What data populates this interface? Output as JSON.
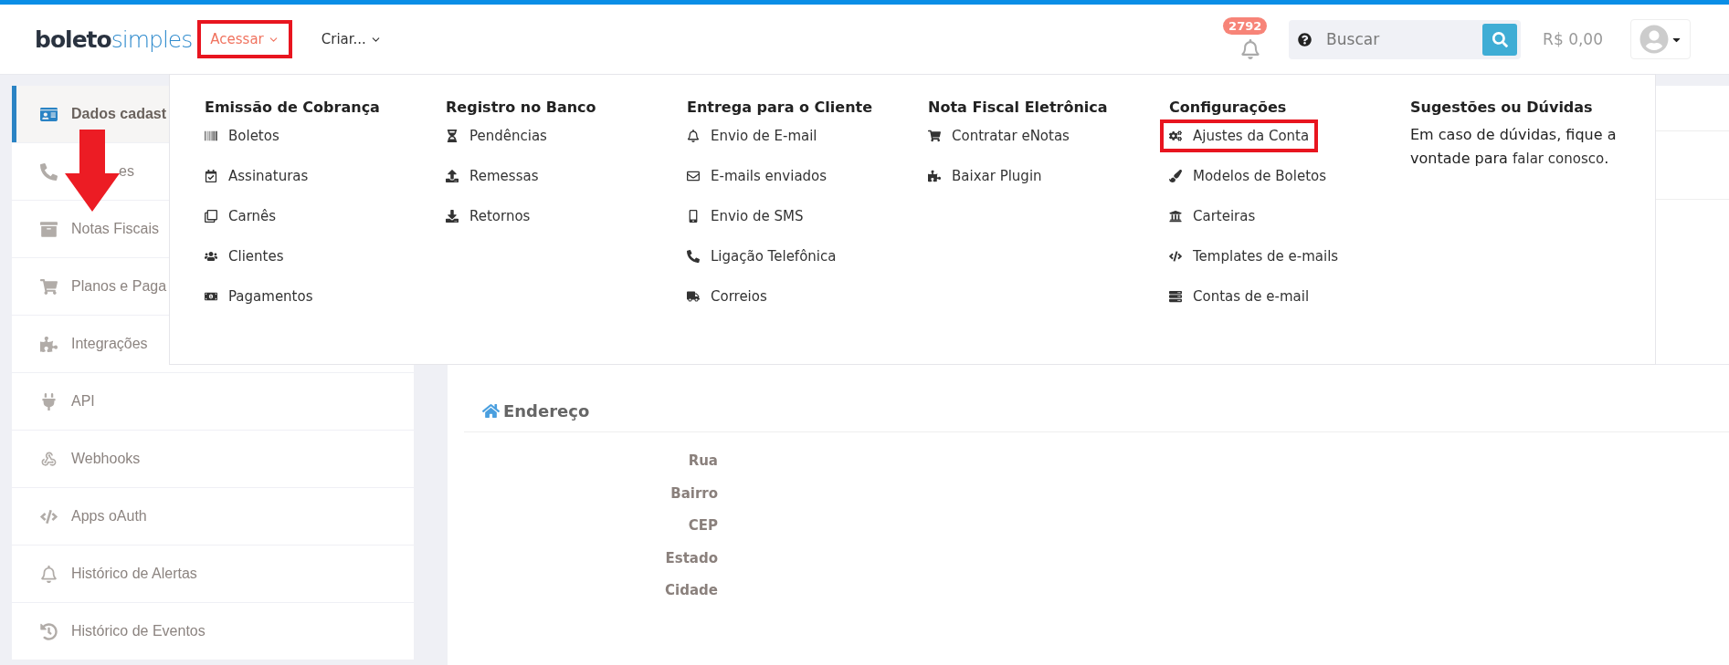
{
  "logo": {
    "dark": "boleto",
    "light": "simples"
  },
  "nav": [
    {
      "label": "Acessar",
      "open": true,
      "highlighted": true
    },
    {
      "label": "Criar...",
      "open": false,
      "highlighted": false
    }
  ],
  "notifications": {
    "count": "2792"
  },
  "search": {
    "placeholder": "Buscar"
  },
  "balance": "R$ 0,00",
  "sidebar": {
    "items": [
      {
        "label": "Dados cadast",
        "selected": true,
        "marked": false
      },
      {
        "label": "es",
        "selected": false,
        "marked": true
      },
      {
        "label": "Notas Fiscais",
        "selected": false,
        "marked": false
      },
      {
        "label": "Planos e Paga",
        "selected": false,
        "marked": false
      },
      {
        "label": "Integrações",
        "selected": false,
        "marked": false
      },
      {
        "label": "API",
        "selected": false,
        "marked": false
      },
      {
        "label": "Webhooks",
        "selected": false,
        "marked": false
      },
      {
        "label": "Apps oAuth",
        "selected": false,
        "marked": false
      },
      {
        "label": "Histórico de Alertas",
        "selected": false,
        "marked": false
      },
      {
        "label": "Histórico de Eventos",
        "selected": false,
        "marked": false
      }
    ]
  },
  "menu": {
    "columns": [
      {
        "title": "Emissão de Cobrança",
        "items": [
          {
            "label": "Boletos",
            "highlighted": false
          },
          {
            "label": "Assinaturas",
            "highlighted": false
          },
          {
            "label": "Carnês",
            "highlighted": false
          },
          {
            "label": "Clientes",
            "highlighted": false
          },
          {
            "label": "Pagamentos",
            "highlighted": false
          }
        ]
      },
      {
        "title": "Registro no Banco",
        "items": [
          {
            "label": "Pendências",
            "highlighted": false
          },
          {
            "label": "Remessas",
            "highlighted": false
          },
          {
            "label": "Retornos",
            "highlighted": false
          }
        ]
      },
      {
        "title": "Entrega para o Cliente",
        "items": [
          {
            "label": "Envio de E-mail",
            "highlighted": false
          },
          {
            "label": "E-mails enviados",
            "highlighted": false
          },
          {
            "label": "Envio de SMS",
            "highlighted": false
          },
          {
            "label": "Ligação Telefônica",
            "highlighted": false
          },
          {
            "label": "Correios",
            "highlighted": false
          }
        ]
      },
      {
        "title": "Nota Fiscal Eletrônica",
        "items": [
          {
            "label": "Contratar eNotas",
            "highlighted": false
          },
          {
            "label": "Baixar Plugin",
            "highlighted": false
          }
        ]
      },
      {
        "title": "Configurações",
        "items": [
          {
            "label": "Ajustes da Conta",
            "highlighted": true
          },
          {
            "label": "Modelos de Boletos",
            "highlighted": false
          },
          {
            "label": "Carteiras",
            "highlighted": false
          },
          {
            "label": "Templates de e-mails",
            "highlighted": false
          },
          {
            "label": "Contas de e-mail",
            "highlighted": false
          }
        ]
      },
      {
        "title": "Sugestões ou Dúvidas",
        "text": "Em caso de dúvidas, fique a vontade para",
        "link": "falar conosco",
        "end": "."
      }
    ]
  },
  "address": {
    "title": "Endereço",
    "fields": [
      "Rua",
      "Bairro",
      "CEP",
      "Estado",
      "Cidade"
    ]
  }
}
